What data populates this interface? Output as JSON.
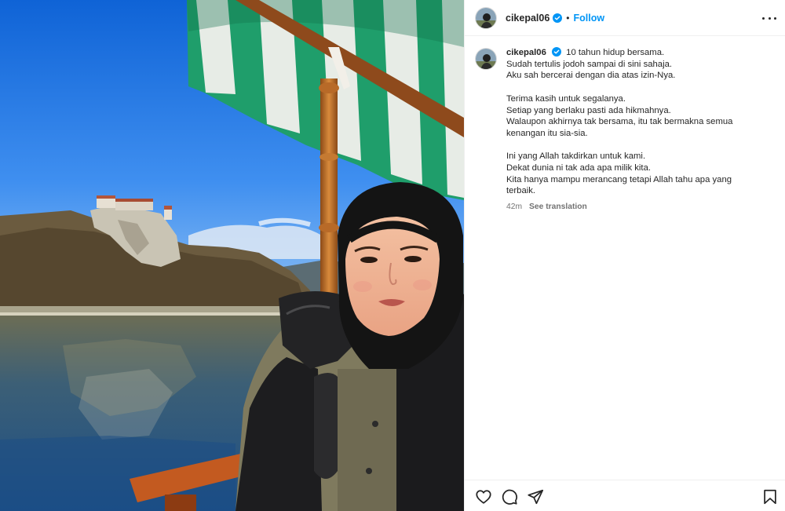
{
  "post": {
    "username": "cikepal06",
    "follow_label": "Follow",
    "separator": "•",
    "caption": {
      "first_line": "10 tahun hidup bersama.",
      "lines": [
        "Sudah tertulis jodoh sampai di sini sahaja.",
        "Aku sah bercerai dengan dia atas izin-Nya.",
        "",
        "Terima kasih untuk segalanya.",
        "Setiap yang berlaku pasti ada hikmahnya.",
        "Walaupon akhirnya tak bersama, itu tak bermakna semua",
        "kenangan itu sia-sia.",
        "",
        "Ini yang Allah takdirkan untuk kami.",
        "Dekat dunia ni tak ada apa milik kita.",
        "Kita hanya mampu merancang tetapi Allah tahu apa yang",
        "terbaik."
      ]
    },
    "time_ago": "42m",
    "see_translation": "See translation"
  },
  "icons": {
    "verified": "verified-badge-icon",
    "more": "more-options-icon",
    "like": "heart-icon",
    "comment": "comment-icon",
    "share": "share-icon",
    "save": "bookmark-icon"
  },
  "colors": {
    "accent": "#0095f6",
    "verified": "#0095f6",
    "text": "#262626",
    "muted": "#737373"
  }
}
